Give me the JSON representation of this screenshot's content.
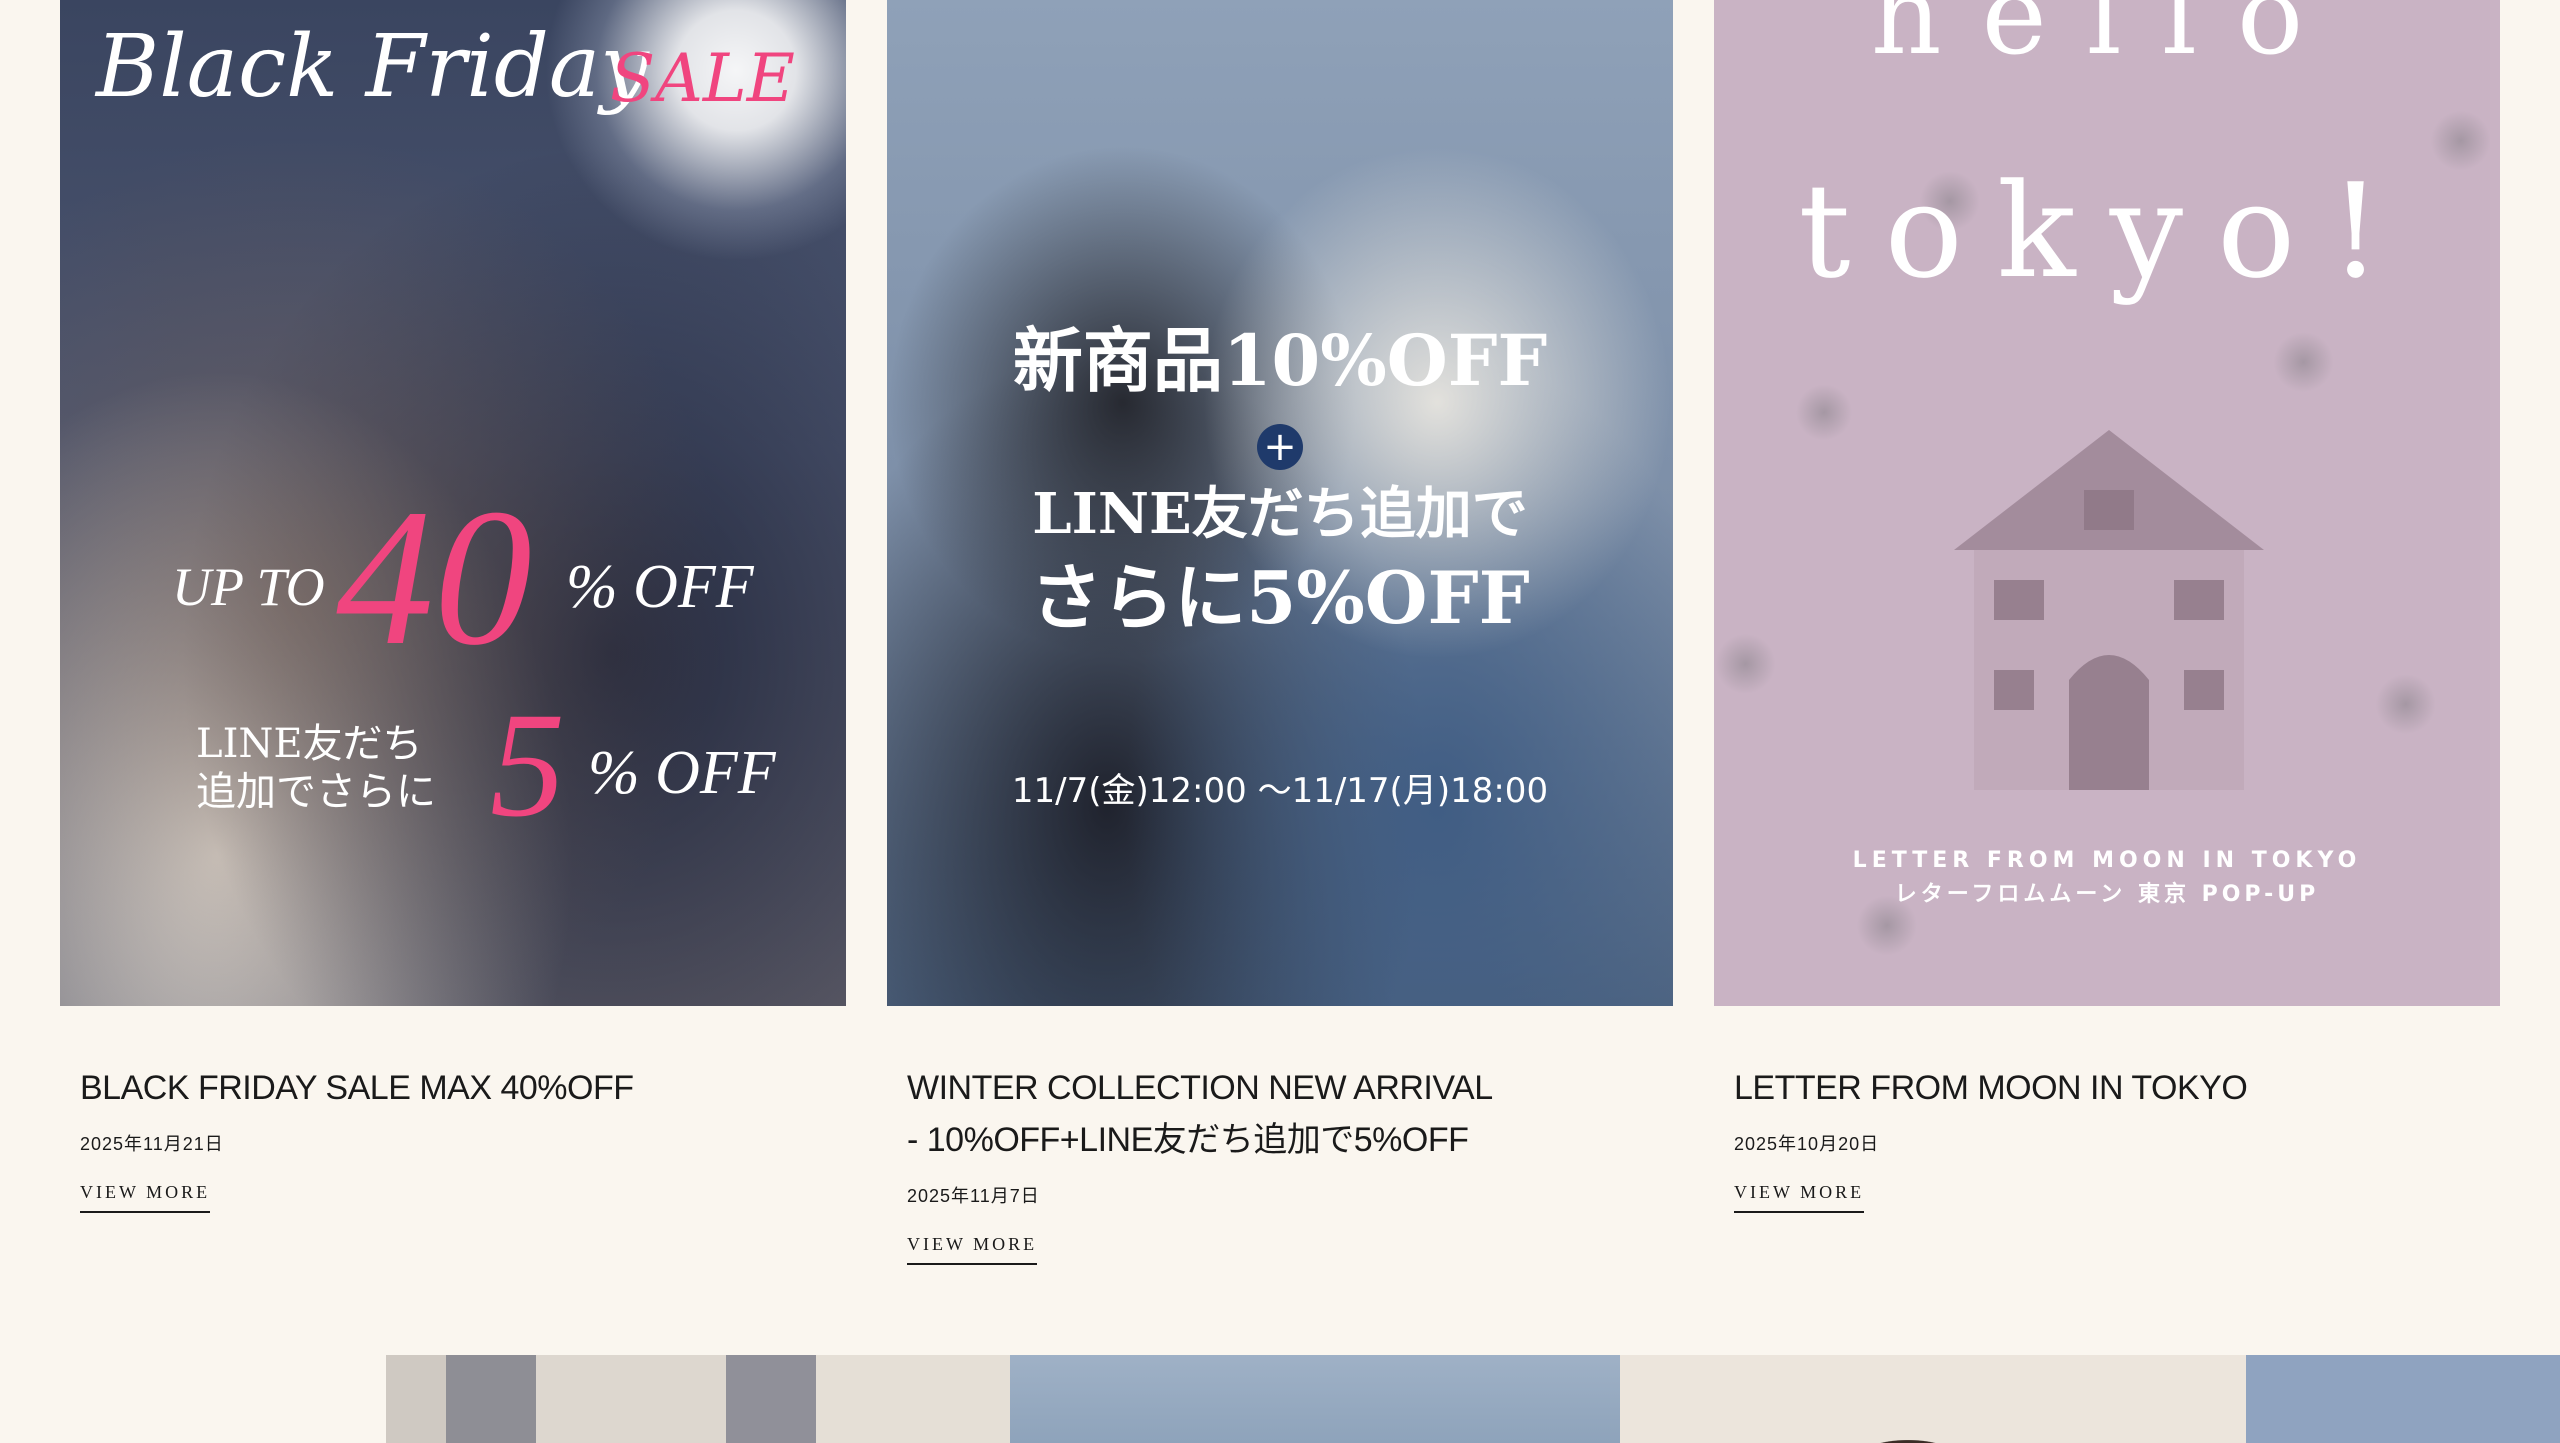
{
  "colors": {
    "page_background": "#faf6ef",
    "text": "#1a1a1a",
    "sale_pink": "#f0457f",
    "plus_badge_navy": "#1f3a6b",
    "card3_background": "#c9b3c4"
  },
  "cards": [
    {
      "title": "BLACK FRIDAY SALE MAX 40%OFF",
      "date": "2025年11月21日",
      "link_label": "VIEW MORE",
      "image": {
        "script_title": "Black Friday",
        "sale_label": "SALE",
        "up_to": "UP TO",
        "big_percent": "40",
        "off_1": "% OFF",
        "line_text": "LINE友だち 追加でさらに",
        "small_percent": "5",
        "off_2": "% OFF"
      }
    },
    {
      "title": "WINTER COLLECTION NEW ARRIVAL - 10%OFF+LINE友だち追加で5%OFF",
      "date": "2025年11月7日",
      "link_label": "VIEW MORE",
      "image": {
        "line1": "新商品10%OFF",
        "plus": "+",
        "line2": "LINE友だち追加で",
        "line3": "さらに5%OFF",
        "period": "11/7(金)12:00 〜11/17(月)18:00"
      }
    },
    {
      "title": "LETTER FROM MOON IN TOKYO",
      "date": "2025年10月20日",
      "link_label": "VIEW MORE",
      "image": {
        "hello": "hello",
        "tokyo": "tokyo!",
        "caption_en": "LETTER FROM MOON IN TOKYO",
        "caption_jp": "レターフロムムーン 東京 POP-UP"
      }
    }
  ]
}
